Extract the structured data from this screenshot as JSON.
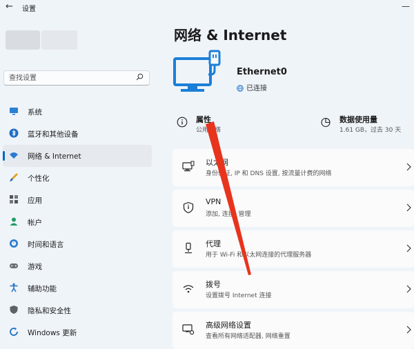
{
  "window": {
    "title": "设置"
  },
  "search": {
    "placeholder": "查找设置"
  },
  "nav": [
    {
      "label": "系统",
      "icon": "monitor-icon",
      "active": false
    },
    {
      "label": "蓝牙和其他设备",
      "icon": "bluetooth-icon",
      "active": false
    },
    {
      "label": "网络 & Internet",
      "icon": "wifi-icon",
      "active": true
    },
    {
      "label": "个性化",
      "icon": "brush-icon",
      "active": false
    },
    {
      "label": "应用",
      "icon": "apps-icon",
      "active": false
    },
    {
      "label": "帐户",
      "icon": "person-icon",
      "active": false
    },
    {
      "label": "时间和语言",
      "icon": "clock-globe-icon",
      "active": false
    },
    {
      "label": "游戏",
      "icon": "gamepad-icon",
      "active": false
    },
    {
      "label": "辅助功能",
      "icon": "accessibility-icon",
      "active": false
    },
    {
      "label": "隐私和安全性",
      "icon": "shield-icon",
      "active": false
    },
    {
      "label": "Windows 更新",
      "icon": "update-icon",
      "active": false
    }
  ],
  "page": {
    "title": "网络 & Internet"
  },
  "adapter": {
    "name": "Ethernet0",
    "status": "已连接"
  },
  "properties": {
    "title": "属性",
    "subtitle": "公用网络"
  },
  "data_usage": {
    "title": "数据使用量",
    "subtitle": "1.61 GB，过去 30 天"
  },
  "cards": [
    {
      "title": "以太网",
      "desc": "身份验证, IP 和 DNS 设置, 按流量计费的网络"
    },
    {
      "title": "VPN",
      "desc": "添加, 连接, 管理"
    },
    {
      "title": "代理",
      "desc": "用于 Wi-Fi 和以太网连接的代理服务器"
    },
    {
      "title": "拨号",
      "desc": "设置拨号 Internet 连接"
    },
    {
      "title": "高级网络设置",
      "desc": "查看所有网络适配器, 网络重置"
    }
  ],
  "colors": {
    "accent": "#0067c0",
    "annotation": "#e8341c",
    "background": "#eff4f9"
  }
}
